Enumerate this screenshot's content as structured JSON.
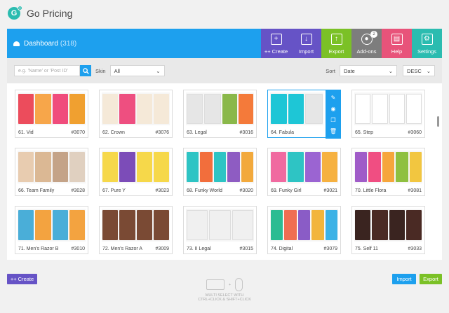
{
  "app": {
    "title": "Go Pricing",
    "logo_letter": "G",
    "logo_badge": "+"
  },
  "dashboard": {
    "title": "Dashboard",
    "count": "(318)"
  },
  "toolbar": [
    {
      "label": "++ Create",
      "icon": "plus-square-icon",
      "glyph": "+",
      "color": "#6653c6"
    },
    {
      "label": "Import",
      "icon": "import-icon",
      "glyph": "↓",
      "color": "#6653c6"
    },
    {
      "label": "Export",
      "icon": "export-icon",
      "glyph": "↑",
      "color": "#7bc126"
    },
    {
      "label": "Add-ons",
      "icon": "bomb-icon",
      "glyph": "●",
      "color": "#7d7d7d",
      "badge": "2"
    },
    {
      "label": "Help",
      "icon": "book-icon",
      "glyph": "▤",
      "color": "#e8537a"
    },
    {
      "label": "Settings",
      "icon": "gear-icon",
      "glyph": "⚙",
      "color": "#2bbcb0"
    }
  ],
  "filter": {
    "search_placeholder": "e.g. 'Name' or 'Post ID'",
    "skin_label": "Skin",
    "skin_value": "All",
    "sort_label": "Sort",
    "sort_value": "Date",
    "order_value": "DESC"
  },
  "tables": [
    {
      "name": "61. Vid",
      "id": "#3070",
      "colors": [
        "#ec4c5c",
        "#f7a64a",
        "#f04c7c",
        "#f0a030"
      ]
    },
    {
      "name": "62. Crown",
      "id": "#3076",
      "colors": [
        "#f5e9d8",
        "#ee4f80",
        "#f5e9d8",
        "#f5e9d8"
      ]
    },
    {
      "name": "63. Legal",
      "id": "#3016",
      "colors": [
        "#e6e6e6",
        "#e6e6e6",
        "#8ab84a",
        "#f47a3a"
      ]
    },
    {
      "name": "64. Fabula",
      "id": "",
      "colors": [
        "#1ec6d6",
        "#1ec6d6",
        "#e6e6e6"
      ],
      "selected": true
    },
    {
      "name": "65. Step",
      "id": "#3060",
      "colors": [
        "#ffffff",
        "#ffffff",
        "#ffffff",
        "#ffffff"
      ]
    },
    {
      "name": "66. Team Family",
      "id": "#3028",
      "colors": [
        "#e8ccb0",
        "#dbb894",
        "#c4a388",
        "#e0d0c0"
      ]
    },
    {
      "name": "67. Pure Y",
      "id": "#3023",
      "colors": [
        "#f6d84a",
        "#7c4cb8",
        "#f6d84a",
        "#f6d84a"
      ]
    },
    {
      "name": "68. Funky World",
      "id": "#3020",
      "colors": [
        "#2ec4c4",
        "#f26e3c",
        "#2ec4c4",
        "#8e5cc2",
        "#f2a93c"
      ]
    },
    {
      "name": "69. Funky Girl",
      "id": "#3021",
      "colors": [
        "#f06aa0",
        "#2ec4c4",
        "#9b64d2",
        "#f6b140"
      ]
    },
    {
      "name": "70. Little Flora",
      "id": "#3081",
      "colors": [
        "#a05cc8",
        "#f04e82",
        "#f6a63c",
        "#8fc040",
        "#f2c640"
      ]
    },
    {
      "name": "71. Men's Razor B",
      "id": "#3010",
      "colors": [
        "#4aaed8",
        "#f3a340",
        "#4aaed8",
        "#f3a340"
      ]
    },
    {
      "name": "72. Men's Razor A",
      "id": "#3009",
      "colors": [
        "#7a4a34",
        "#7a4a34",
        "#7a4a34",
        "#7a4a34"
      ]
    },
    {
      "name": "73. II Legal",
      "id": "#3015",
      "colors": [
        "#f0f0f0",
        "#f0f0f0",
        "#f0f0f0"
      ]
    },
    {
      "name": "74. Digital",
      "id": "#3079",
      "colors": [
        "#2bbc92",
        "#f06e52",
        "#8a5cc6",
        "#f2b53c",
        "#3cb2e6"
      ]
    },
    {
      "name": "75. Self 11",
      "id": "#3033",
      "colors": [
        "#3a2420",
        "#4a2a24",
        "#3a2420",
        "#4a2a24"
      ]
    }
  ],
  "hover_actions": [
    "pencil-icon",
    "eye-icon",
    "copy-icon",
    "trash-icon"
  ],
  "bottom": {
    "create_label": "++ Create",
    "import_label": "Import",
    "export_label": "Export",
    "hint_line1": "MULTI SELECT WITH",
    "hint_line2": "CTRL+CLICK & SHIFT+CLICK"
  }
}
